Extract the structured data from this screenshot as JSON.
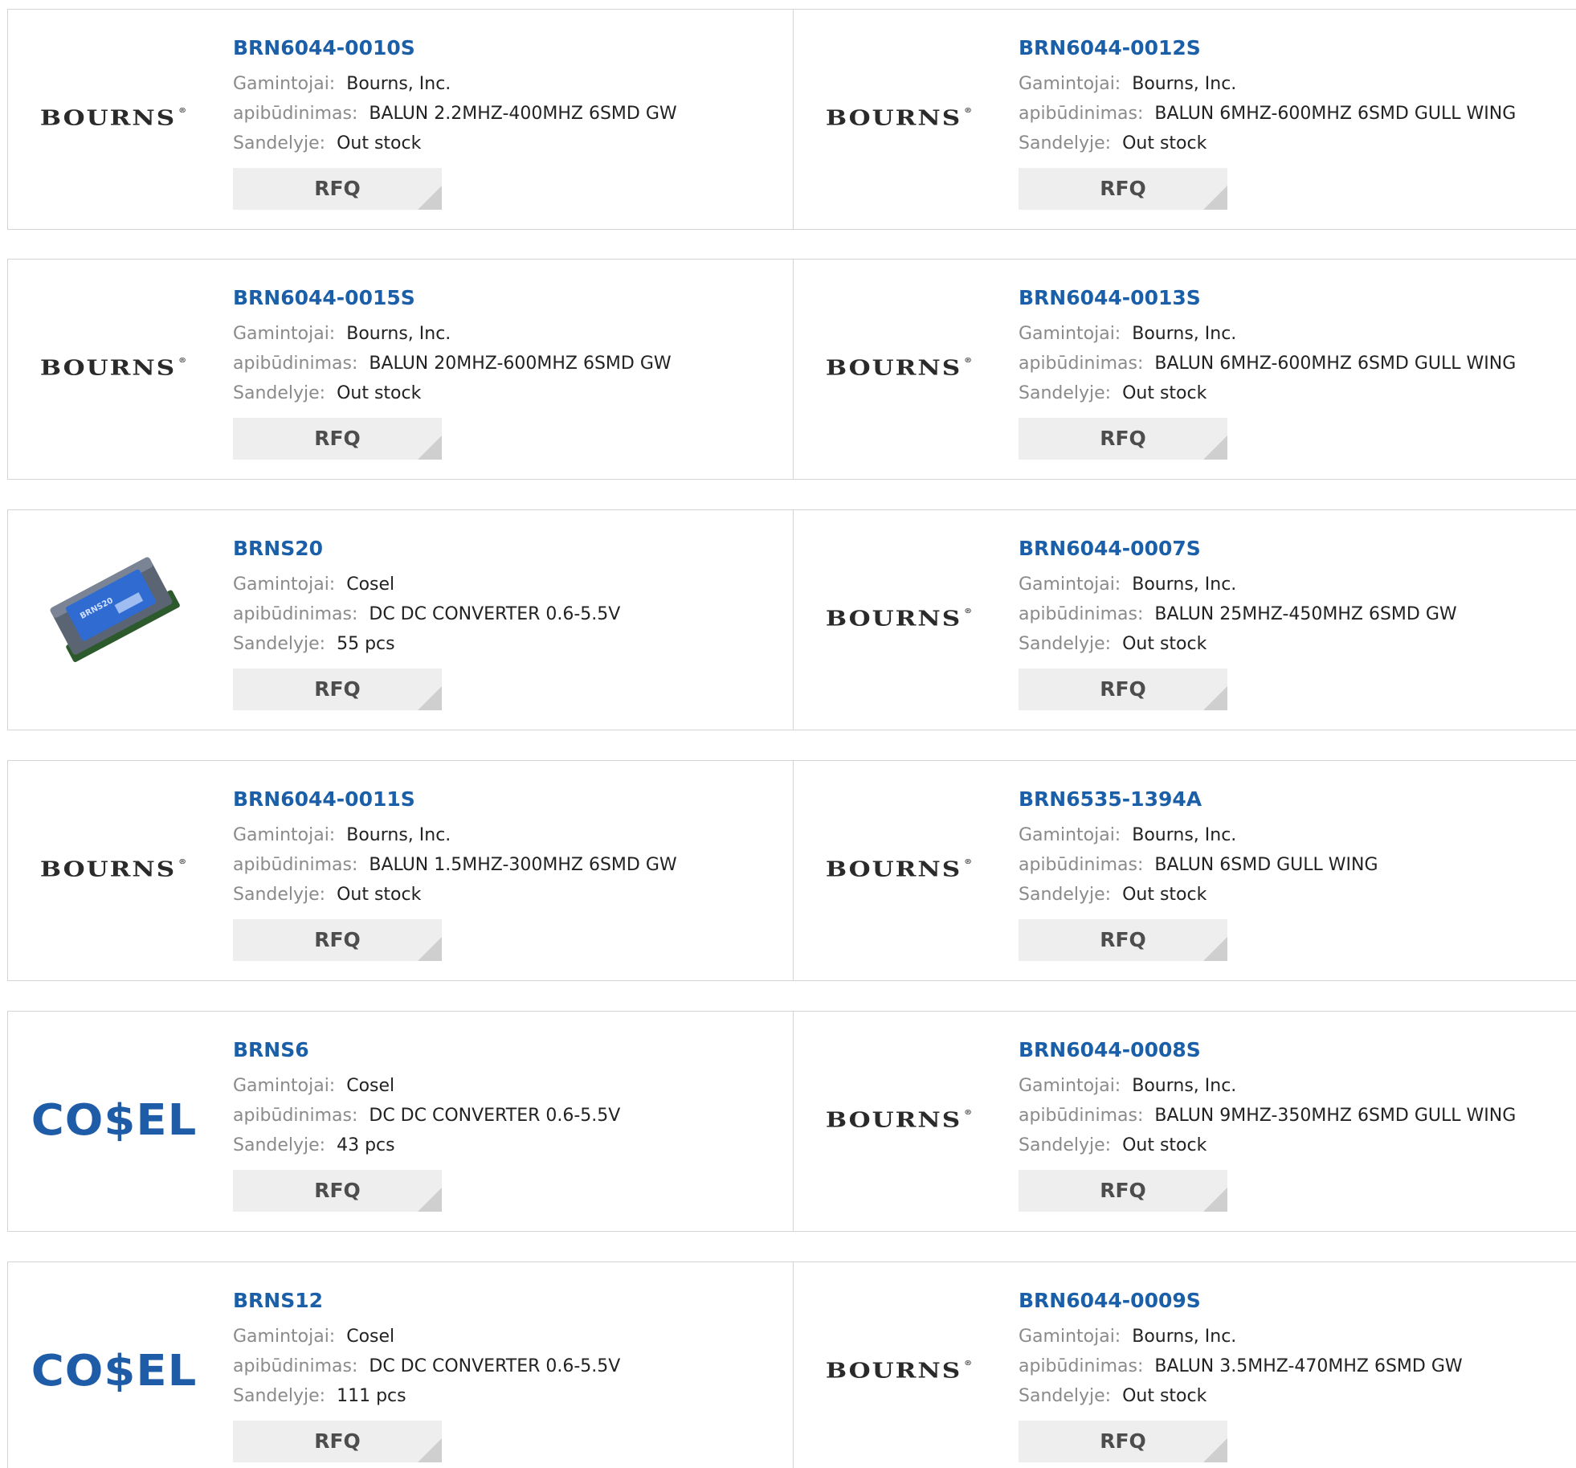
{
  "labels": {
    "manufacturer": "Gamintojai:",
    "description": "apibūdinimas:",
    "stock": "Sandelyje:",
    "rfq": "RFQ"
  },
  "logos": {
    "bourns": "BOURNS",
    "cosel": "CO$EL",
    "product_marking": "BRNS20"
  },
  "colors": {
    "link": "#1b5fa8",
    "label": "#8a8a8a",
    "button_bg": "#eeeeee",
    "cosel_blue": "#1f5ca8",
    "border": "#d4d4d4"
  },
  "products": [
    {
      "part": "BRN6044-0010S",
      "manufacturer": "Bourns, Inc.",
      "description": "BALUN 2.2MHZ-400MHZ 6SMD GW",
      "stock": "Out stock",
      "image": "bourns-logo"
    },
    {
      "part": "BRN6044-0012S",
      "manufacturer": "Bourns, Inc.",
      "description": "BALUN 6MHZ-600MHZ 6SMD GULL WING",
      "stock": "Out stock",
      "image": "bourns-logo"
    },
    {
      "part": "BRN6044-0015S",
      "manufacturer": "Bourns, Inc.",
      "description": "BALUN 20MHZ-600MHZ 6SMD GW",
      "stock": "Out stock",
      "image": "bourns-logo"
    },
    {
      "part": "BRN6044-0013S",
      "manufacturer": "Bourns, Inc.",
      "description": "BALUN 6MHZ-600MHZ 6SMD GULL WING",
      "stock": "Out stock",
      "image": "bourns-logo"
    },
    {
      "part": "BRNS20",
      "manufacturer": "Cosel",
      "description": "DC DC CONVERTER 0.6-5.5V",
      "stock": "55 pcs",
      "image": "dc-converter-photo"
    },
    {
      "part": "BRN6044-0007S",
      "manufacturer": "Bourns, Inc.",
      "description": "BALUN 25MHZ-450MHZ 6SMD GW",
      "stock": "Out stock",
      "image": "bourns-logo"
    },
    {
      "part": "BRN6044-0011S",
      "manufacturer": "Bourns, Inc.",
      "description": "BALUN 1.5MHZ-300MHZ 6SMD GW",
      "stock": "Out stock",
      "image": "bourns-logo"
    },
    {
      "part": "BRN6535-1394A",
      "manufacturer": "Bourns, Inc.",
      "description": "BALUN 6SMD GULL WING",
      "stock": "Out stock",
      "image": "bourns-logo"
    },
    {
      "part": "BRNS6",
      "manufacturer": "Cosel",
      "description": "DC DC CONVERTER 0.6-5.5V",
      "stock": "43 pcs",
      "image": "cosel-logo"
    },
    {
      "part": "BRN6044-0008S",
      "manufacturer": "Bourns, Inc.",
      "description": "BALUN 9MHZ-350MHZ 6SMD GULL WING",
      "stock": "Out stock",
      "image": "bourns-logo"
    },
    {
      "part": "BRNS12",
      "manufacturer": "Cosel",
      "description": "DC DC CONVERTER 0.6-5.5V",
      "stock": "111 pcs",
      "image": "cosel-logo"
    },
    {
      "part": "BRN6044-0009S",
      "manufacturer": "Bourns, Inc.",
      "description": "BALUN 3.5MHZ-470MHZ 6SMD GW",
      "stock": "Out stock",
      "image": "bourns-logo"
    }
  ]
}
